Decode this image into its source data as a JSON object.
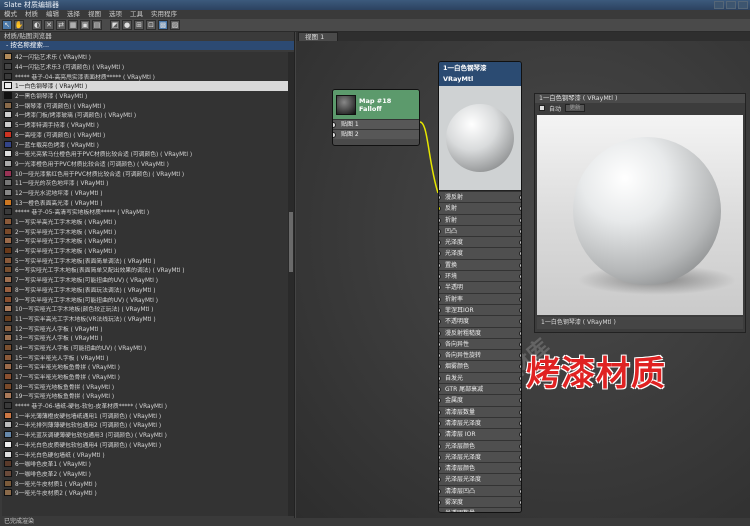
{
  "window": {
    "title": "Slate 材质编辑器"
  },
  "menu": [
    "模式",
    "材质",
    "编辑",
    "选择",
    "视图",
    "选项",
    "工具",
    "实用程序"
  ],
  "browser": {
    "title": "材质/贴图浏览器",
    "header": "- 按名称搜索..."
  },
  "tree": [
    {
      "label": "42一闪钻艺术乐 ( VRayMtl )",
      "color": "#b08a5a",
      "sel": false
    },
    {
      "label": "44一闪钻艺术乐3 (可调颜色) ( VRayMtl )",
      "color": "#444444",
      "sel": false
    },
    {
      "label": "***** 巷子-04-高亮甩实漆表面材质***** ( VRayMtl )",
      "color": "#3a3a3a",
      "sel": false
    },
    {
      "label": "1一白色钢琴漆 ( VRayMtl )",
      "color": "#eeeeee",
      "sel": true
    },
    {
      "label": "2一黑色钢琴漆 ( VRayMtl )",
      "color": "#111111",
      "sel": false
    },
    {
      "label": "3一钢琴漆 (可调颜色) ( VRayMtl )",
      "color": "#8a6a4a",
      "sel": false
    },
    {
      "label": "4一烤漆门板/烤漆玻璃 (可调颜色) ( VRayMtl )",
      "color": "#d0d0d0",
      "sel": false
    },
    {
      "label": "5一烤漆特调手持漆 ( VRayMtl )",
      "color": "#cccccc",
      "sel": false
    },
    {
      "label": "6一高哑漆 (可调颜色) ( VRayMtl )",
      "color": "#cc3322",
      "sel": false
    },
    {
      "label": "7一蓝车载亮色烤漆 ( VRayMtl )",
      "color": "#334488",
      "sel": false
    },
    {
      "label": "8一哑光亮紫马仕橙色用于PVC材质比较合适 (可调颜色) ( VRayMtl )",
      "color": "#dddddd",
      "sel": false
    },
    {
      "label": "9一光漆橙色用于PVC材质比较合适 (可调颜色) ( VRayMtl )",
      "color": "#aaaaaa",
      "sel": false
    },
    {
      "label": "10一哑光漆紫红色用于PVC材质比较合适 (可调颜色) ( VRayMtl )",
      "color": "#993355",
      "sel": false
    },
    {
      "label": "11一哑光的灰色地坪漆 ( VRayMtl )",
      "color": "#777777",
      "sel": false
    },
    {
      "label": "12一哑光水泥地坪漆 ( VRayMtl )",
      "color": "#888888",
      "sel": false
    },
    {
      "label": "13一橙色表面高光漆 ( VRayMtl )",
      "color": "#cc7722",
      "sel": false
    },
    {
      "label": "***** 巷子-05-高清写实地板材质***** ( VRayMtl )",
      "color": "#3a3a3a",
      "sel": false
    },
    {
      "label": "1一写实半高光工字木地板 ( VRayMtl )",
      "color": "#8a5a3a",
      "sel": false
    },
    {
      "label": "2一写实半哑光工字木地板 ( VRayMtl )",
      "color": "#7a4a2a",
      "sel": false
    },
    {
      "label": "3一写实半哑光工字木地板 ( VRayMtl )",
      "color": "#9a6a4a",
      "sel": false
    },
    {
      "label": "4一写实半哑光工字木地板 ( VRayMtl )",
      "color": "#6a3a1a",
      "sel": false
    },
    {
      "label": "5一写实半哑光工字木地板(表面简单调法) ( VRayMtl )",
      "color": "#8a5a3a",
      "sel": false
    },
    {
      "label": "6一写实哑光工字木地板(表面简单又配出效果的调法) ( VRayMtl )",
      "color": "#7a5030",
      "sel": false
    },
    {
      "label": "7一写实半哑光工字木地板(可能扭曲的UV) ( VRayMtl )",
      "color": "#a07050",
      "sel": false
    },
    {
      "label": "8一写实半哑光工字木地板(表面玩法调法) ( VRayMtl )",
      "color": "#9a6040",
      "sel": false
    },
    {
      "label": "9一写实半哑光工字木地板(可能扭曲的UV) ( VRayMtl )",
      "color": "#8a5030",
      "sel": false
    },
    {
      "label": "10一写实哑光工字木地板(颜色较正玩法) ( VRayMtl )",
      "color": "#aa7a5a",
      "sel": false
    },
    {
      "label": "11一写实半高光工字木地板(VR法线玩法) ( VRayMtl )",
      "color": "#6a4020",
      "sel": false
    },
    {
      "label": "12一写实哑光人字板 ( VRayMtl )",
      "color": "#8a6040",
      "sel": false
    },
    {
      "label": "13一写实哑光人字板 ( VRayMtl )",
      "color": "#9a7050",
      "sel": false
    },
    {
      "label": "14一写实哑光人字板 (可能扭曲的UV) ( VRayMtl )",
      "color": "#7a5030",
      "sel": false
    },
    {
      "label": "15一写实半哑光人字板 ( VRayMtl )",
      "color": "#8a5a3a",
      "sel": false
    },
    {
      "label": "16一写实半哑光地板鱼骨拼 ( VRayMtl )",
      "color": "#9a6a4a",
      "sel": false
    },
    {
      "label": "17一写实半哑光地板鱼骨拼 ( VRayMtl )",
      "color": "#8a5030",
      "sel": false
    },
    {
      "label": "18一写实哑光地板鱼骨拼 ( VRayMtl )",
      "color": "#7a4a2a",
      "sel": false
    },
    {
      "label": "19一写实哑光地板鱼骨拼 ( VRayMtl )",
      "color": "#aa7a5a",
      "sel": false
    },
    {
      "label": "***** 巷子-06-墙纸-硬包-软包-皮革材质***** ( VRayMtl )",
      "color": "#3a3a3a",
      "sel": false
    },
    {
      "label": "1一半光薄薄橙皮硬包墙纸通用1 (可调颜色) ( VRayMtl )",
      "color": "#cc7744",
      "sel": false
    },
    {
      "label": "2一半光排列薄薄硬包软包通用2 (可调颜色) ( VRayMtl )",
      "color": "#bbbbbb",
      "sel": false
    },
    {
      "label": "3一半光蓝灰调硬薄硬包软包通用3 (可调颜色) ( VRayMtl )",
      "color": "#6688aa",
      "sel": false
    },
    {
      "label": "4一半光白色皮质硬包软包通用4 (可调颜色) ( VRayMtl )",
      "color": "#eeeeee",
      "sel": false
    },
    {
      "label": "5一半光白色硬包墙纸 ( VRayMtl )",
      "color": "#dddddd",
      "sel": false
    },
    {
      "label": "6一咖啡色皮革1 ( VRayMtl )",
      "color": "#5a3a2a",
      "sel": false
    },
    {
      "label": "7一咖啡色皮革2 ( VRayMtl )",
      "color": "#6a4a3a",
      "sel": false
    },
    {
      "label": "8一哑光牛皮材质1 ( VRayMtl )",
      "color": "#7a5a3a",
      "sel": false
    },
    {
      "label": "9一哑光牛皮材质2 ( VRayMtl )",
      "color": "#8a6a4a",
      "sel": false
    }
  ],
  "view": {
    "tab": "视图 1"
  },
  "falloff": {
    "line1": "Map #18",
    "line2": "Falloff",
    "slots": [
      "贴图 1",
      "贴图 2"
    ]
  },
  "material": {
    "name": "1一白色钢琴漆",
    "type": "VRayMtl",
    "slots": [
      "漫反射",
      "反射",
      "折射",
      "凹凸",
      "光泽度",
      "光泽度",
      "置换",
      "环境",
      "半透明",
      "折射率",
      "菲涅耳IOR",
      "不透明度",
      "漫反射粗糙度",
      "各向异性",
      "各向异性旋转",
      "烟雾颜色",
      "自发光",
      "GTR 尾部衰减",
      "金属度",
      "清漆层数量",
      "清漆层光泽度",
      "清漆层 IOR",
      "光泽层颜色",
      "光泽层光泽度",
      "清漆层颜色",
      "光泽层光泽度",
      "清漆层凹凸",
      "雾深度",
      "半透明数量",
      "薄膜厚度",
      "薄膜 IOR"
    ]
  },
  "preview": {
    "title": "1一白色钢琴漆 ( VRayMtl )",
    "auto": "自动",
    "update": "更新",
    "footer": "1一白色钢琴漆 ( VRayMtl )"
  },
  "banner": "烤漆材质",
  "status": "已完成渲染",
  "watermark": "AN素材库"
}
